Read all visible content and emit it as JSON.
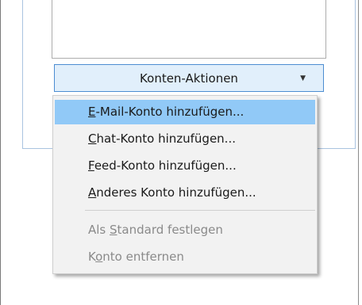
{
  "account_actions": {
    "button_label": "Konten-Aktionen",
    "dropdown_icon": "chevron-down-icon"
  },
  "menu": {
    "items": [
      {
        "key": "E",
        "rest": "-Mail-Konto hinzufügen...",
        "highlighted": true,
        "enabled": true
      },
      {
        "key": "C",
        "rest": "hat-Konto hinzufügen...",
        "highlighted": false,
        "enabled": true
      },
      {
        "key": "F",
        "rest": "eed-Konto hinzufügen...",
        "highlighted": false,
        "enabled": true
      },
      {
        "key": "A",
        "rest": "nderes Konto hinzufügen...",
        "highlighted": false,
        "enabled": true
      }
    ],
    "disabled_items": [
      {
        "before": "Als ",
        "key": "S",
        "rest": "tandard festlegen"
      },
      {
        "before": "K",
        "key": "o",
        "rest": "nto entfernen"
      }
    ]
  },
  "colors": {
    "highlight": "#91c9f7",
    "button_bg": "#e1effb",
    "button_border": "#4c8dd1",
    "disabled_text": "#8a8a8a"
  }
}
